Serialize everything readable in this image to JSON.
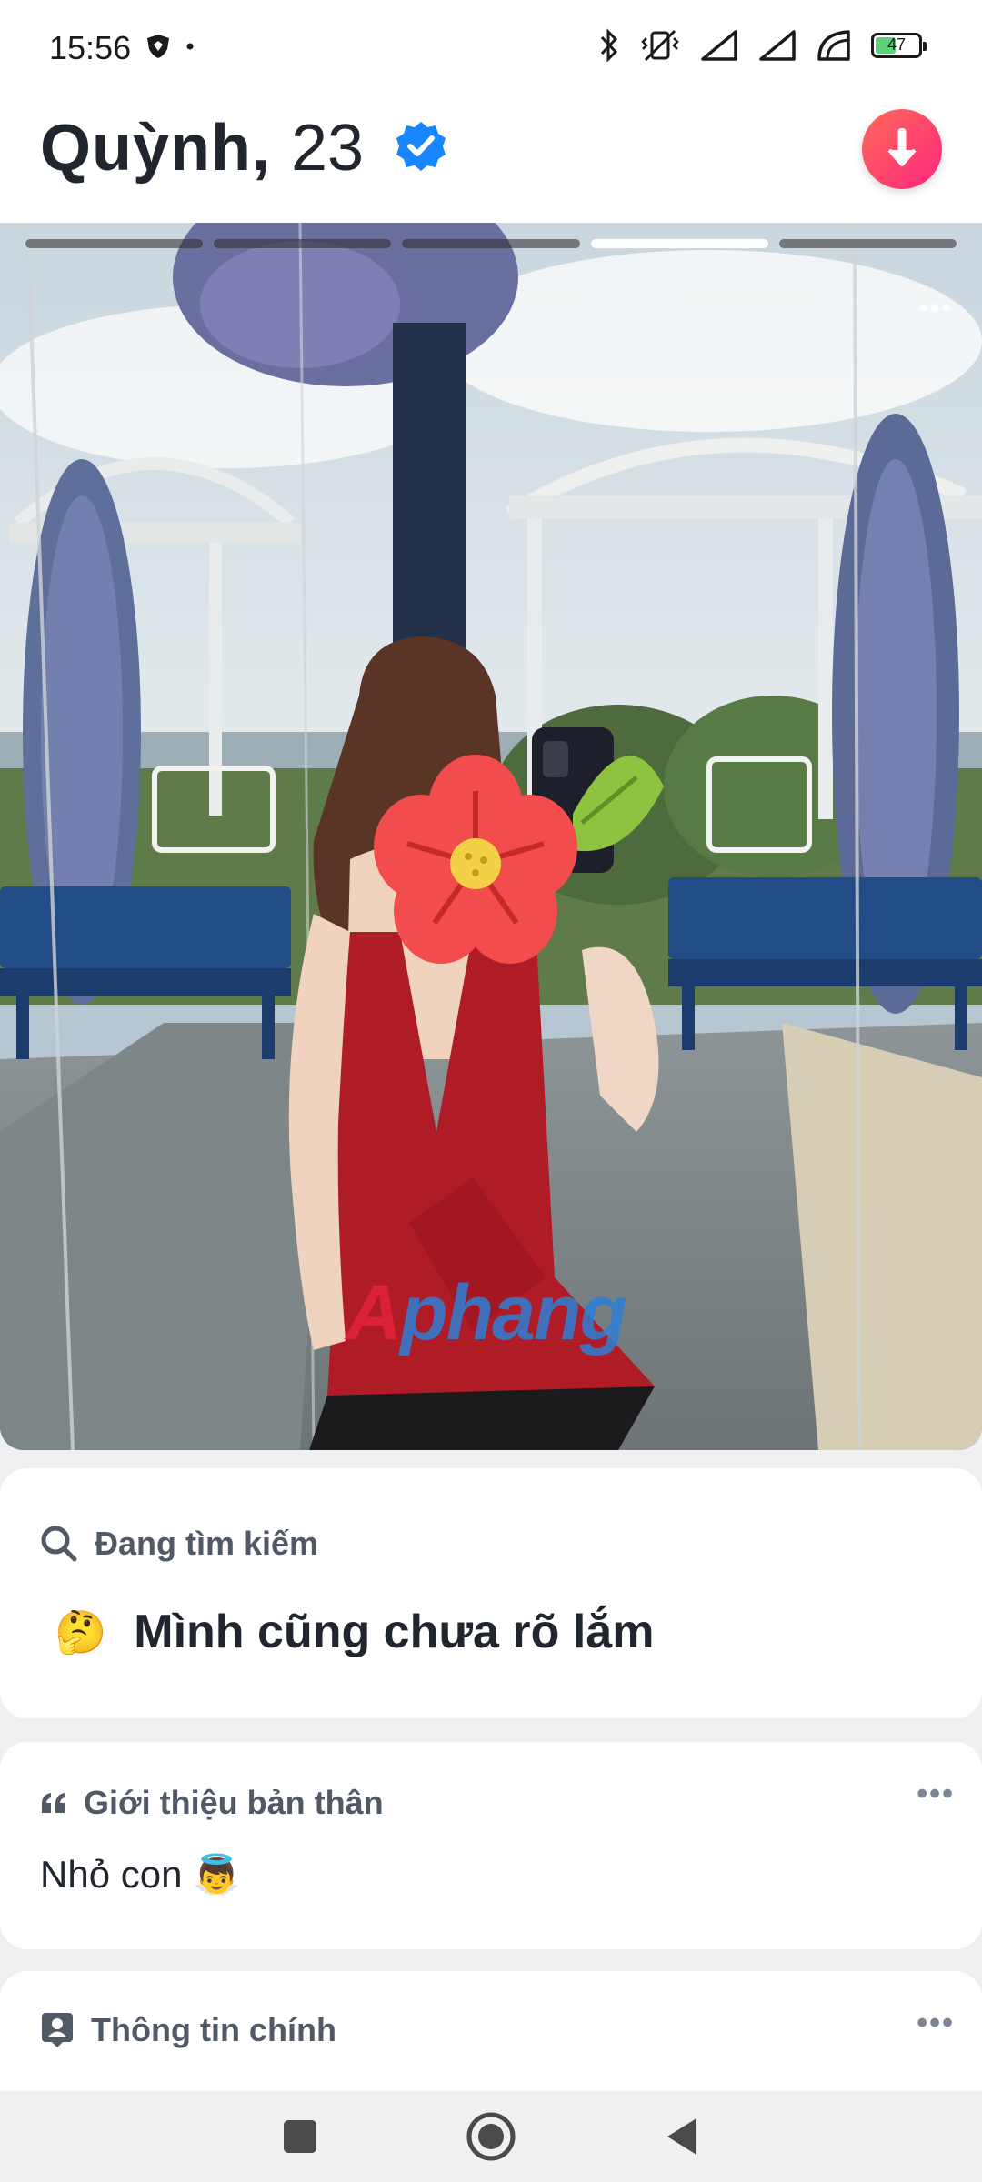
{
  "status_bar": {
    "time": "15:56",
    "battery_level": "47",
    "battery_fraction": 0.47,
    "icons": [
      "shield-icon",
      "dot-icon",
      "bluetooth-icon",
      "vibrate-icon",
      "signal-icon",
      "signal-icon",
      "wifi-icon",
      "battery-icon"
    ]
  },
  "header": {
    "name": "Quỳnh,",
    "age": "23",
    "verified": true,
    "collapse_icon": "arrow-down-icon",
    "accent_color": "#fd267d"
  },
  "photo": {
    "total_photos": 5,
    "active_index": 4,
    "more_icon": "more-horizontal-icon",
    "watermark": {
      "part1": "A",
      "part2": "phang"
    }
  },
  "looking_for": {
    "label": "Đang tìm kiếm",
    "icon": "search-icon",
    "emoji": "🤔",
    "value": "Mình cũng chưa rõ lắm"
  },
  "about": {
    "label": "Giới thiệu bản thân",
    "icon": "quote-icon",
    "text": "Nhỏ con 👼",
    "more_icon": "more-horizontal-icon"
  },
  "basics": {
    "label": "Thông tin chính",
    "icon": "id-badge-icon",
    "more_icon": "more-horizontal-icon"
  },
  "nav": {
    "buttons": [
      "recents-icon",
      "home-icon",
      "back-icon"
    ]
  }
}
